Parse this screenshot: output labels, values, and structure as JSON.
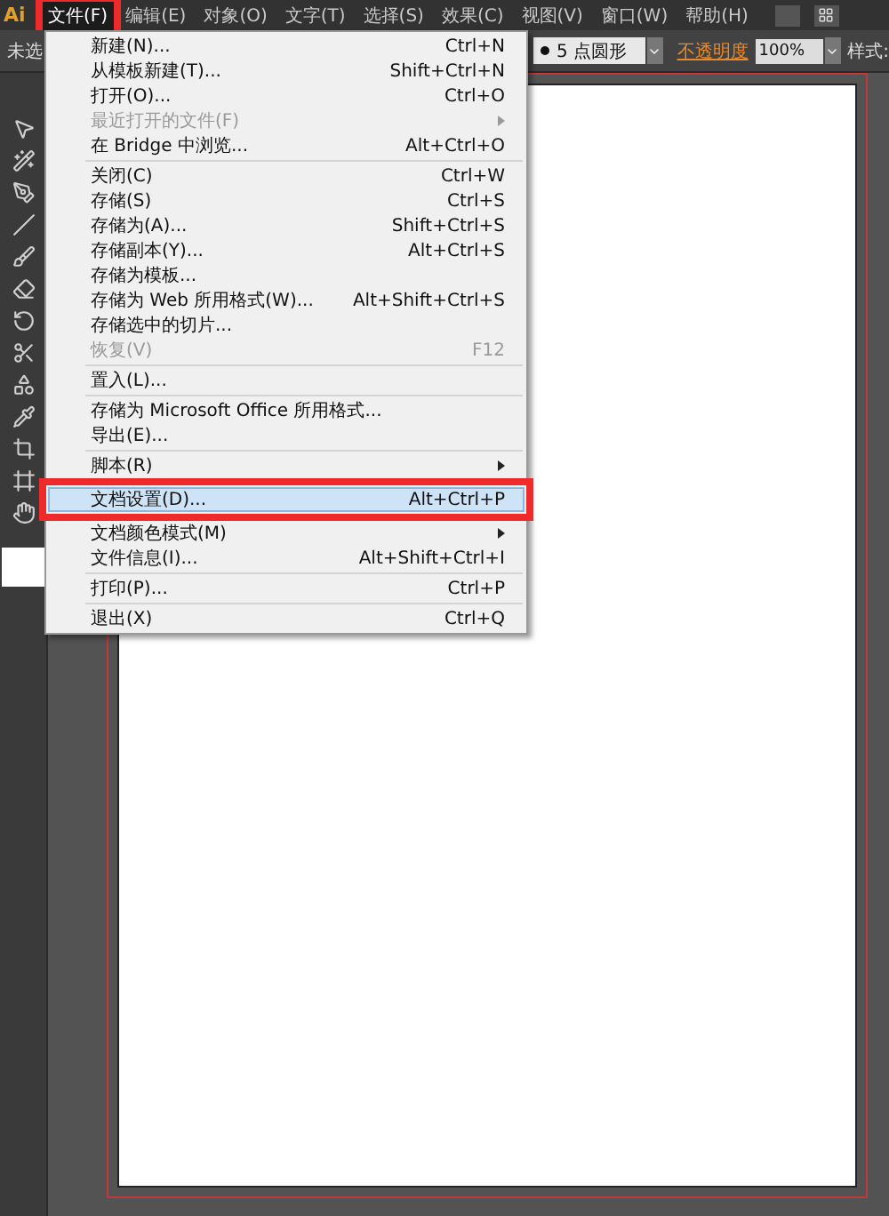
{
  "menubar": {
    "logo": "Ai",
    "items": [
      {
        "label": "文件(F)",
        "selected": true
      },
      {
        "label": "编辑(E)",
        "selected": false
      },
      {
        "label": "对象(O)",
        "selected": false
      },
      {
        "label": "文字(T)",
        "selected": false
      },
      {
        "label": "选择(S)",
        "selected": false
      },
      {
        "label": "效果(C)",
        "selected": false
      },
      {
        "label": "视图(V)",
        "selected": false
      },
      {
        "label": "窗口(W)",
        "selected": false
      },
      {
        "label": "帮助(H)",
        "selected": false
      }
    ]
  },
  "control_bar": {
    "selection_label": "未选",
    "brush": "5 点圆形",
    "opacity_label": "不透明度",
    "opacity_value": "100%",
    "style_label": "样式:"
  },
  "file_menu": [
    {
      "kind": "item",
      "label": "新建(N)...",
      "shortcut": "Ctrl+N",
      "disabled": false,
      "submenu": false,
      "selected": false
    },
    {
      "kind": "item",
      "label": "从模板新建(T)...",
      "shortcut": "Shift+Ctrl+N",
      "disabled": false,
      "submenu": false,
      "selected": false
    },
    {
      "kind": "item",
      "label": "打开(O)...",
      "shortcut": "Ctrl+O",
      "disabled": false,
      "submenu": false,
      "selected": false
    },
    {
      "kind": "item",
      "label": "最近打开的文件(F)",
      "disabled": true,
      "submenu": true,
      "selected": false
    },
    {
      "kind": "item",
      "label": "在 Bridge 中浏览...",
      "shortcut": "Alt+Ctrl+O",
      "disabled": false,
      "submenu": false,
      "selected": false
    },
    {
      "kind": "separator"
    },
    {
      "kind": "item",
      "label": "关闭(C)",
      "shortcut": "Ctrl+W",
      "disabled": false,
      "submenu": false,
      "selected": false
    },
    {
      "kind": "item",
      "label": "存储(S)",
      "shortcut": "Ctrl+S",
      "disabled": false,
      "submenu": false,
      "selected": false
    },
    {
      "kind": "item",
      "label": "存储为(A)...",
      "shortcut": "Shift+Ctrl+S",
      "disabled": false,
      "submenu": false,
      "selected": false
    },
    {
      "kind": "item",
      "label": "存储副本(Y)...",
      "shortcut": "Alt+Ctrl+S",
      "disabled": false,
      "submenu": false,
      "selected": false
    },
    {
      "kind": "item",
      "label": "存储为模板...",
      "disabled": false,
      "submenu": false,
      "selected": false
    },
    {
      "kind": "item",
      "label": "存储为 Web 所用格式(W)...",
      "shortcut": "Alt+Shift+Ctrl+S",
      "disabled": false,
      "submenu": false,
      "selected": false
    },
    {
      "kind": "item",
      "label": "存储选中的切片...",
      "disabled": false,
      "submenu": false,
      "selected": false
    },
    {
      "kind": "item",
      "label": "恢复(V)",
      "shortcut": "F12",
      "disabled": true,
      "submenu": false,
      "selected": false
    },
    {
      "kind": "separator"
    },
    {
      "kind": "item",
      "label": "置入(L)...",
      "disabled": false,
      "submenu": false,
      "selected": false
    },
    {
      "kind": "separator"
    },
    {
      "kind": "item",
      "label": "存储为 Microsoft Office 所用格式...",
      "disabled": false,
      "submenu": false,
      "selected": false
    },
    {
      "kind": "item",
      "label": "导出(E)...",
      "disabled": false,
      "submenu": false,
      "selected": false
    },
    {
      "kind": "separator"
    },
    {
      "kind": "item",
      "label": "脚本(R)",
      "disabled": false,
      "submenu": true,
      "selected": false
    },
    {
      "kind": "separator"
    },
    {
      "kind": "item",
      "label": "文档设置(D)...",
      "shortcut": "Alt+Ctrl+P",
      "disabled": false,
      "submenu": false,
      "selected": true
    },
    {
      "kind": "item",
      "label": "文档颜色模式(M)",
      "disabled": false,
      "submenu": true,
      "selected": false
    },
    {
      "kind": "item",
      "label": "文件信息(I)...",
      "shortcut": "Alt+Shift+Ctrl+I",
      "disabled": false,
      "submenu": false,
      "selected": false
    },
    {
      "kind": "separator"
    },
    {
      "kind": "item",
      "label": "打印(P)...",
      "shortcut": "Ctrl+P",
      "disabled": false,
      "submenu": false,
      "selected": false
    },
    {
      "kind": "separator"
    },
    {
      "kind": "item",
      "label": "退出(X)",
      "shortcut": "Ctrl+Q",
      "disabled": false,
      "submenu": false,
      "selected": false
    }
  ]
}
